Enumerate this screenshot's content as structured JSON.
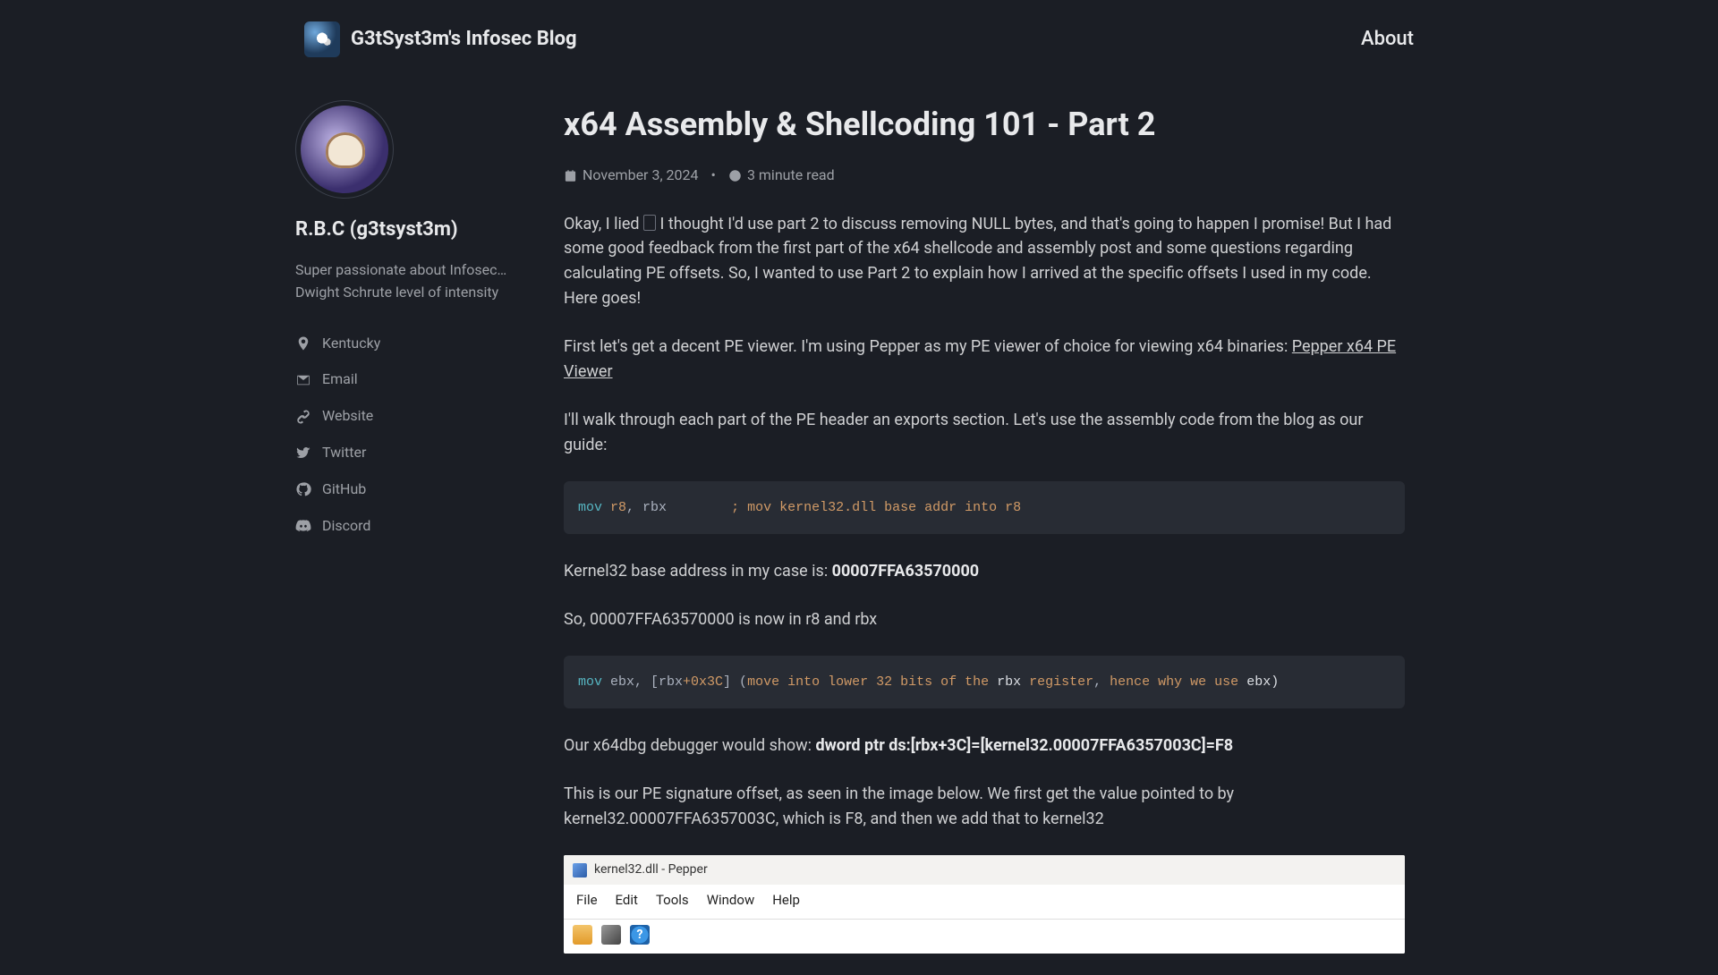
{
  "header": {
    "brand_title": "G3tSyst3m's Infosec Blog",
    "nav_about": "About"
  },
  "sidebar": {
    "author_name": "R.B.C (g3tsyst3m)",
    "author_bio": "Super passionate about Infosec… Dwight Schrute level of intensity",
    "location": "Kentucky",
    "links": {
      "email": "Email",
      "website": "Website",
      "twitter": "Twitter",
      "github": "GitHub",
      "discord": "Discord"
    }
  },
  "post": {
    "title": "x64 Assembly & Shellcoding 101 - Part 2",
    "date": "November 3, 2024",
    "read_time": "3 minute read",
    "meta_sep": "•",
    "p1_a": "Okay, I lied ",
    "p1_b": " I thought I'd use part 2 to discuss removing NULL bytes, and that's going to happen I promise! But I had some good feedback from the first part of the x64 shellcode and assembly post and some questions regarding calculating PE offsets. So, I wanted to use Part 2 to explain how I arrived at the specific offsets I used in my code. Here goes!",
    "p2_a": "First let's get a decent PE viewer. I'm using Pepper as my PE viewer of choice for viewing x64 binaries: ",
    "p2_link": "Pepper x64 PE Viewer",
    "p3": "I'll walk through each part of the PE header an exports section. Let's use the assembly code from the blog as our guide:",
    "code1": {
      "t1": "mov ",
      "t2": "r8",
      "t3": ", rbx        ",
      "t4": "; mov kernel32.dll base addr into r8"
    },
    "p4_a": "Kernel32 base address in my case is: ",
    "p4_b": "00007FFA63570000",
    "p5": "So, 00007FFA63570000 is now in r8 and rbx",
    "code2": {
      "t1": "mov ",
      "t2": "ebx, [rbx",
      "t3": "+0x3C",
      "t4": "] (",
      "t5": "move into lower 32 bits of the ",
      "t6": "rbx ",
      "t7": "register",
      "t8": ", ",
      "t9": "hence why we use ",
      "t10": "ebx)"
    },
    "p6_a": "Our x64dbg debugger would show: ",
    "p6_b": "dword ptr ds:[rbx+3C]=[kernel32.00007FFA6357003C]=F8",
    "p7": "This is our PE signature offset, as seen in the image below. We first get the value pointed to by kernel32.00007FFA6357003C, which is F8, and then we add that to kernel32",
    "pe": {
      "title": "kernel32.dll - Pepper",
      "menus": [
        "File",
        "Edit",
        "Tools",
        "Window",
        "Help"
      ]
    }
  }
}
